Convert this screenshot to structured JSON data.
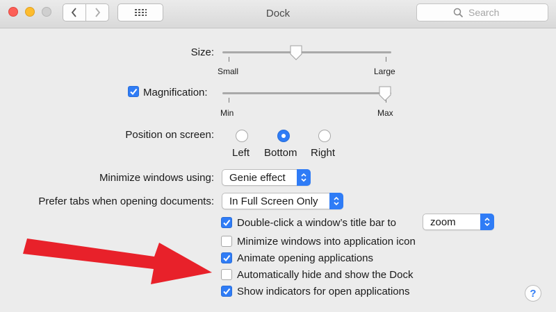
{
  "window": {
    "title": "Dock"
  },
  "search": {
    "placeholder": "Search"
  },
  "size": {
    "label": "Size:",
    "min_label": "Small",
    "max_label": "Large",
    "value": 0.44
  },
  "magnification": {
    "label": "Magnification:",
    "checked": true,
    "min_label": "Min",
    "max_label": "Max",
    "value": 0.96
  },
  "position": {
    "label": "Position on screen:",
    "options": [
      {
        "label": "Left",
        "selected": false
      },
      {
        "label": "Bottom",
        "selected": true
      },
      {
        "label": "Right",
        "selected": false
      }
    ]
  },
  "minimize": {
    "label": "Minimize windows using:",
    "value": "Genie effect"
  },
  "prefer_tabs": {
    "label": "Prefer tabs when opening documents:",
    "value": "In Full Screen Only"
  },
  "options": {
    "double_click": {
      "label": "Double-click a window’s title bar to",
      "checked": true,
      "value": "zoom"
    },
    "minimize_into_icon": {
      "label": "Minimize windows into application icon",
      "checked": false
    },
    "animate": {
      "label": "Animate opening applications",
      "checked": true
    },
    "autohide": {
      "label": "Automatically hide and show the Dock",
      "checked": false
    },
    "indicators": {
      "label": "Show indicators for open applications",
      "checked": true
    }
  },
  "help": {
    "label": "?"
  },
  "colors": {
    "accent": "#2f7cf6",
    "arrow": "#e8212a"
  },
  "icons": {
    "back": "chevron-left-icon",
    "forward": "chevron-right-icon",
    "grid": "grid-icon",
    "search": "search-icon"
  }
}
